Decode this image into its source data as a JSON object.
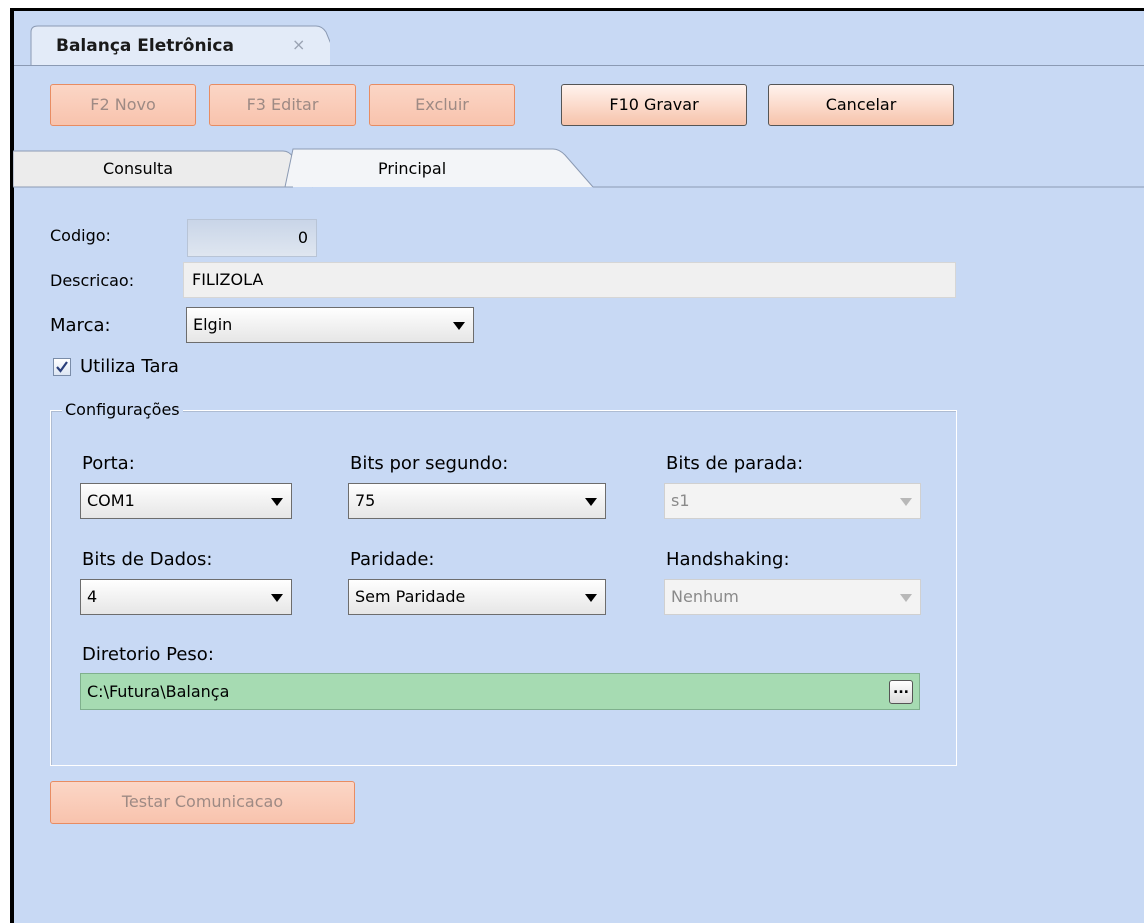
{
  "window": {
    "tab_title": "Balança Eletrônica",
    "tab_close": "×"
  },
  "toolbar": {
    "new_label": "F2 Novo",
    "edit_label": "F3 Editar",
    "delete_label": "Excluir",
    "save_label": "F10 Gravar",
    "cancel_label": "Cancelar"
  },
  "tabs": [
    {
      "label": "Consulta",
      "active": false
    },
    {
      "label": "Principal",
      "active": true
    }
  ],
  "form": {
    "codigo_label": "Codigo:",
    "codigo_value": "0",
    "descricao_label": "Descricao:",
    "descricao_value": "FILIZOLA",
    "marca_label": "Marca:",
    "marca_value": "Elgin",
    "utiliza_tara_label": "Utiliza Tara",
    "utiliza_tara_checked": true
  },
  "config": {
    "group_title": "Configurações",
    "porta_label": "Porta:",
    "porta_value": "COM1",
    "bits_segundo_label": "Bits por segundo:",
    "bits_segundo_value": "75",
    "bits_parada_label": "Bits de parada:",
    "bits_parada_value": "s1",
    "bits_dados_label": "Bits de Dados:",
    "bits_dados_value": "4",
    "paridade_label": "Paridade:",
    "paridade_value": "Sem Paridade",
    "handshaking_label": "Handshaking:",
    "handshaking_value": "Nenhum",
    "diretorio_label": "Diretorio Peso:",
    "diretorio_value": "C:\\Futura\\Balança",
    "browse_label": "..."
  },
  "actions": {
    "test_label": "Testar Comunicacao"
  },
  "colors": {
    "background": "#c8d9f4",
    "button_disabled": "#f8c3ad",
    "button_disabled_border": "#e88c62",
    "directory_field": "#a6dbb2"
  }
}
